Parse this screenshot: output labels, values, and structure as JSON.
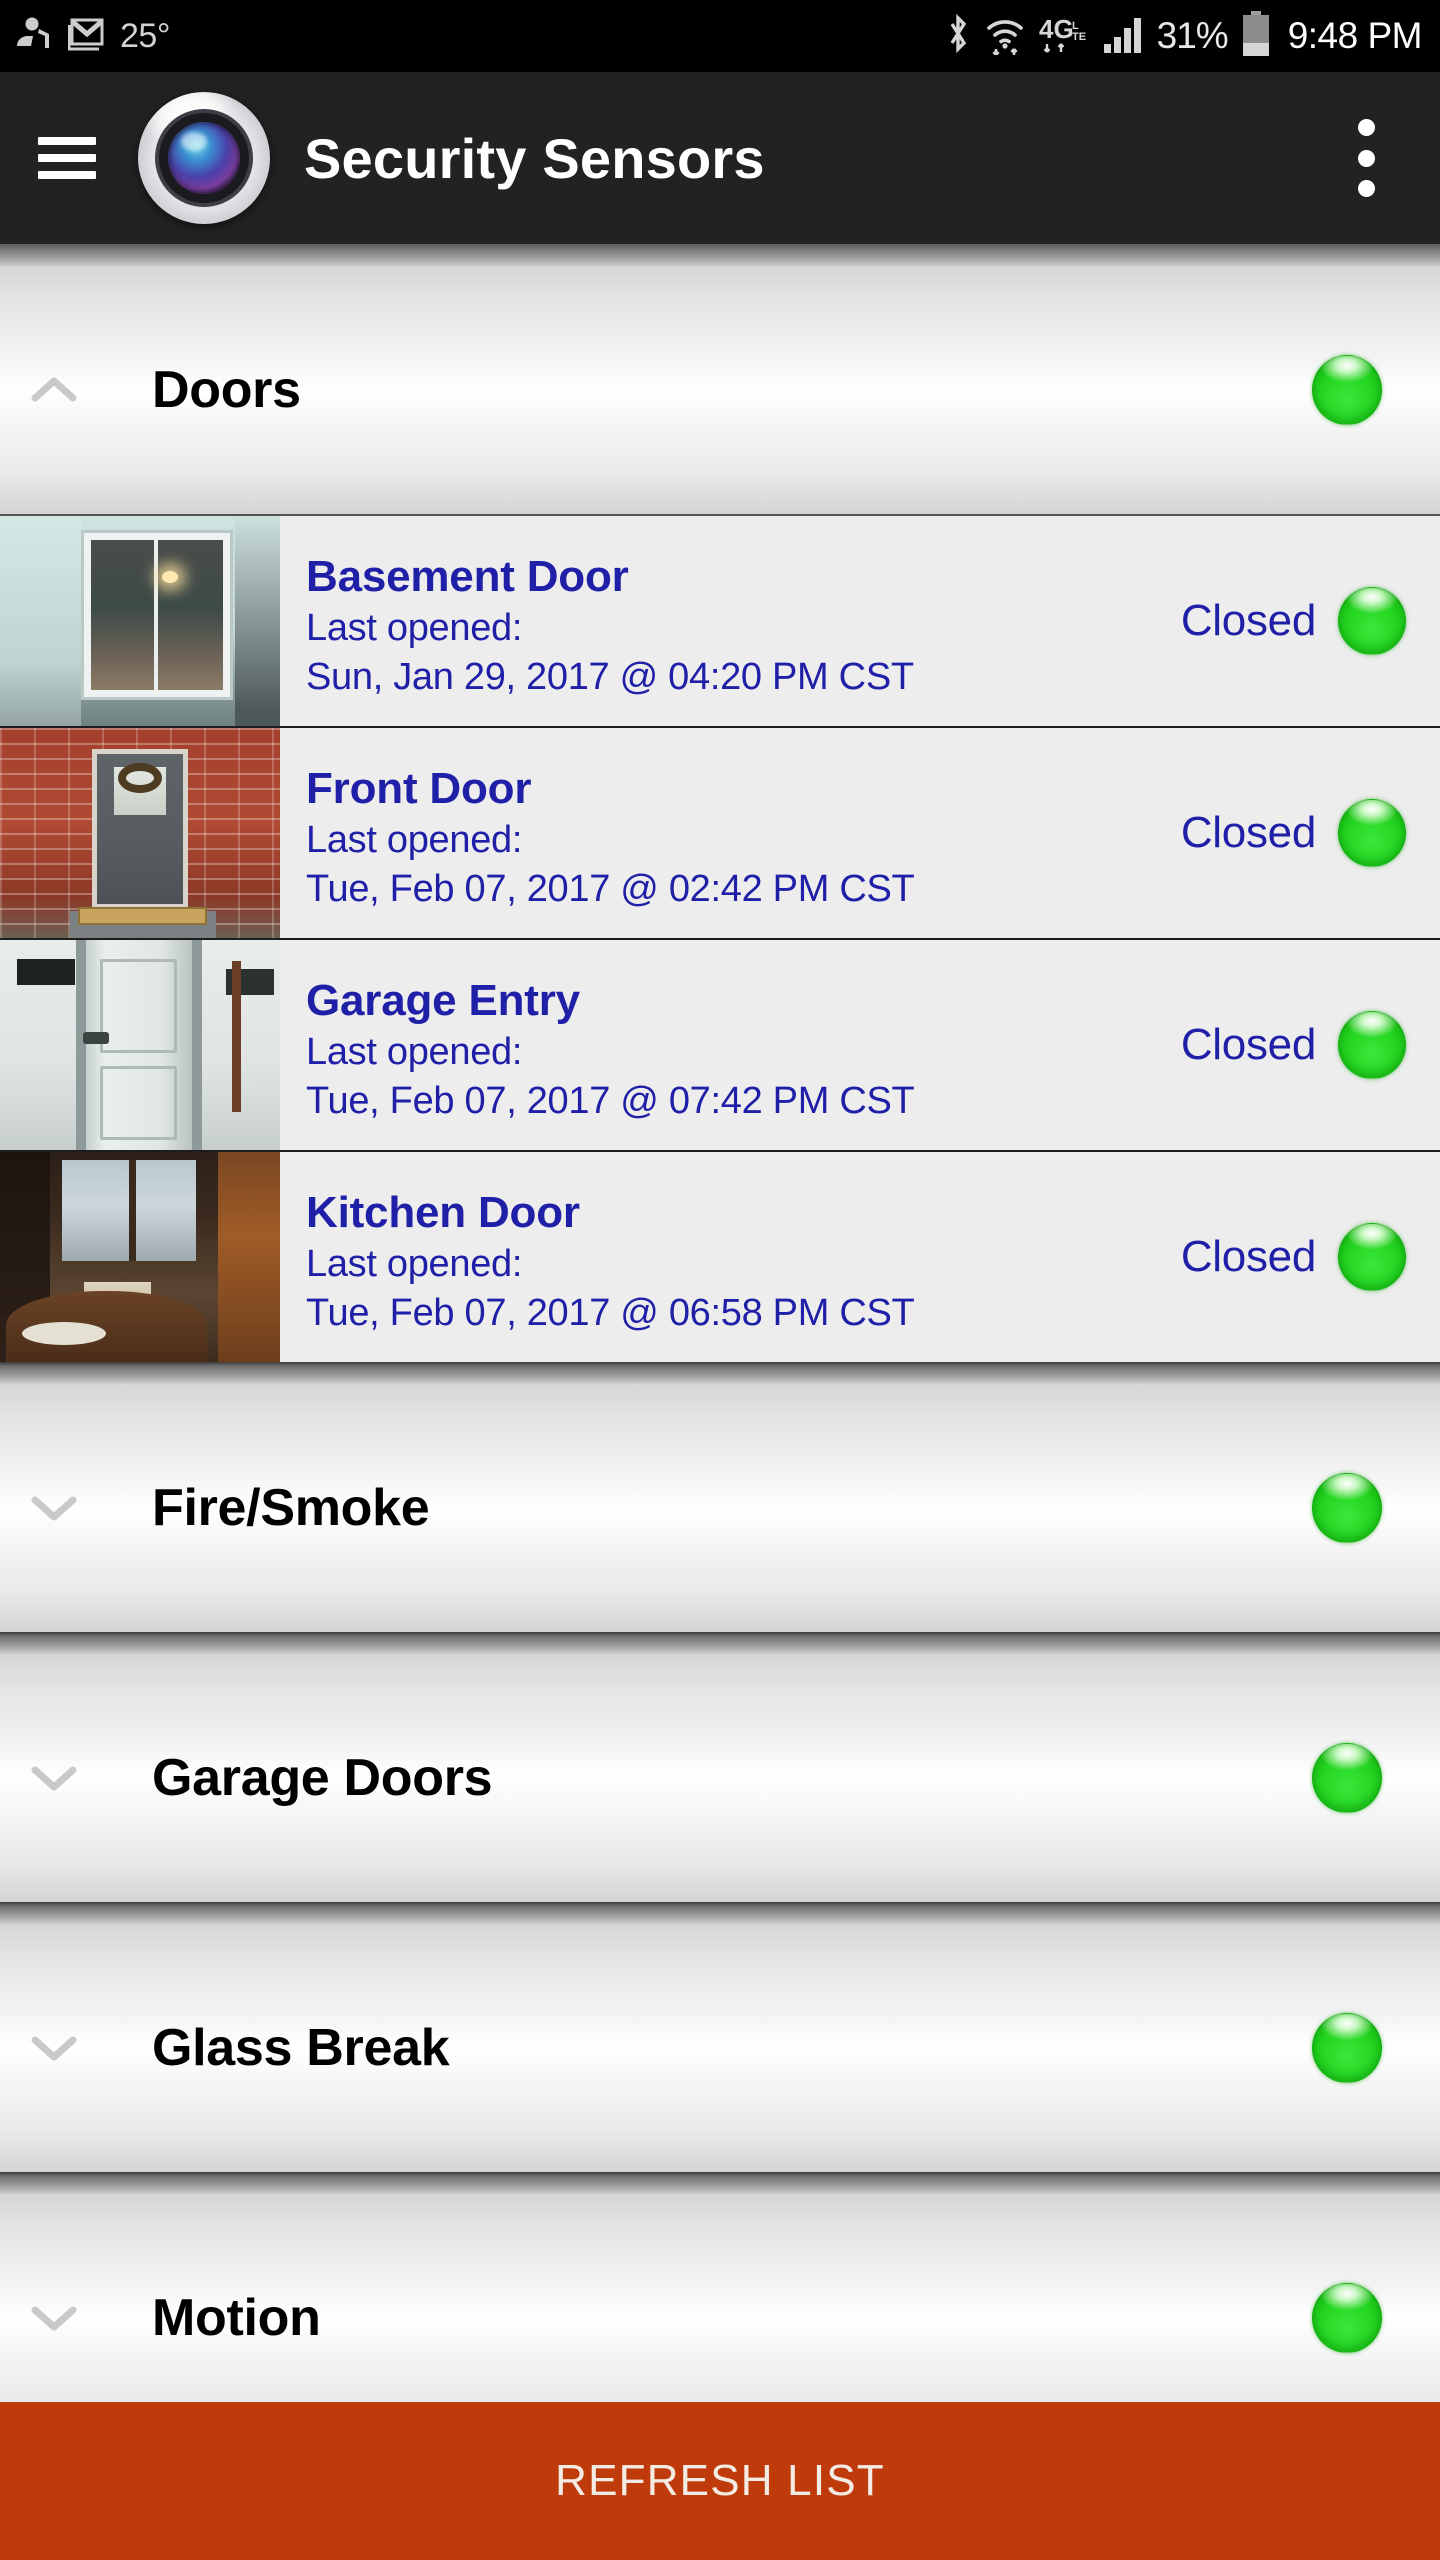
{
  "status_bar": {
    "left_icons": [
      "baby-monitor-icon",
      "gmail-icon"
    ],
    "temperature": "25°",
    "right_icons": [
      "bluetooth-icon",
      "wifi-icon",
      "4g-lte-icon",
      "cellular-signal-icon"
    ],
    "battery_percent": "31%",
    "time": "9:48 PM"
  },
  "app_bar": {
    "menu_icon": "hamburger-menu-icon",
    "logo_icon": "camera-lens-icon",
    "title": "Security Sensors",
    "overflow_icon": "more-vertical-icon"
  },
  "colors": {
    "accent_orange": "#bf3b0b",
    "link_blue": "#1f1fa8",
    "status_green": "#23d41f",
    "appbar_dark": "#222222"
  },
  "sections": [
    {
      "title": "Doors",
      "expanded": true,
      "chevron": "chevron-up-icon",
      "status": "ok",
      "sensors": [
        {
          "name": "Basement Door",
          "last_opened_label": "Last opened:",
          "last_opened_time": "Sun, Jan 29, 2017 @ 04:20 PM CST",
          "status": "Closed",
          "thumbnail": "basement-door-camera-thumbnail"
        },
        {
          "name": "Front Door",
          "last_opened_label": "Last opened:",
          "last_opened_time": "Tue, Feb 07, 2017 @ 02:42 PM CST",
          "status": "Closed",
          "thumbnail": "front-door-camera-thumbnail"
        },
        {
          "name": "Garage Entry",
          "last_opened_label": "Last opened:",
          "last_opened_time": "Tue, Feb 07, 2017 @ 07:42 PM CST",
          "status": "Closed",
          "thumbnail": "garage-entry-camera-thumbnail"
        },
        {
          "name": "Kitchen Door",
          "last_opened_label": "Last opened:",
          "last_opened_time": "Tue, Feb 07, 2017 @ 06:58 PM CST",
          "status": "Closed",
          "thumbnail": "kitchen-door-camera-thumbnail"
        }
      ]
    },
    {
      "title": "Fire/Smoke",
      "expanded": false,
      "chevron": "chevron-down-icon",
      "status": "ok",
      "sensors": []
    },
    {
      "title": "Garage Doors",
      "expanded": false,
      "chevron": "chevron-down-icon",
      "status": "ok",
      "sensors": []
    },
    {
      "title": "Glass Break",
      "expanded": false,
      "chevron": "chevron-down-icon",
      "status": "ok",
      "sensors": []
    },
    {
      "title": "Motion",
      "expanded": false,
      "chevron": "chevron-down-icon",
      "status": "ok",
      "sensors": []
    }
  ],
  "footer": {
    "refresh_label": "REFRESH LIST"
  }
}
